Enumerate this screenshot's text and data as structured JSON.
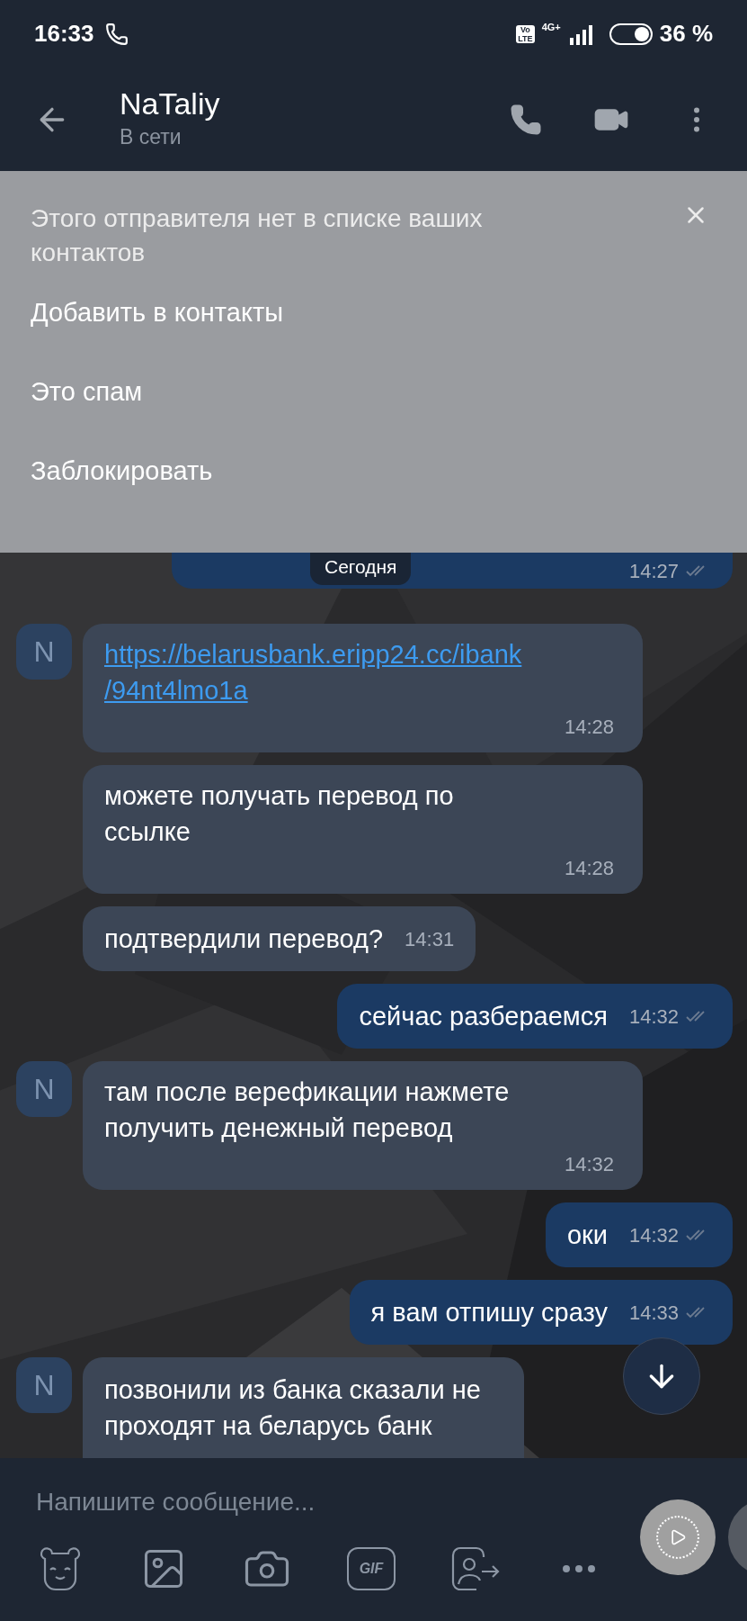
{
  "status_bar": {
    "time": "16:33",
    "volte": [
      "Vo",
      "LTE"
    ],
    "network": "4G+",
    "battery": "36 %"
  },
  "header": {
    "name": "NaTaliy",
    "status": "В сети"
  },
  "banner": {
    "message": "Этого отправителя нет в списке ваших контактов",
    "actions": [
      "Добавить в контакты",
      "Это спам",
      "Заблокировать"
    ]
  },
  "date_chip": "Сегодня",
  "partial_message": {
    "time": "14:27"
  },
  "messages": [
    {
      "kind": "link",
      "outgoing": false,
      "time_beside": false,
      "avatar": "N",
      "text": "https://belarusbank.eripp24.cc/ibank\n/94nt4lmo1a",
      "time": "14:28"
    },
    {
      "kind": "text",
      "outgoing": false,
      "time_beside": false,
      "text": "можете получать перевод по\nссылке",
      "time": "14:28"
    },
    {
      "kind": "text",
      "outgoing": false,
      "time_beside": true,
      "text": "подтвердили перевод?",
      "time": "14:31"
    },
    {
      "kind": "text",
      "outgoing": true,
      "time_beside": true,
      "text": "сейчас разбераемся",
      "time": "14:32"
    },
    {
      "kind": "text",
      "outgoing": false,
      "time_beside": false,
      "avatar": "N",
      "text": "там после верефикации нажмете\nполучить денежный перевод",
      "time": "14:32"
    },
    {
      "kind": "text",
      "outgoing": true,
      "time_beside": true,
      "text": "оки",
      "time": "14:32"
    },
    {
      "kind": "text",
      "outgoing": true,
      "time_beside": true,
      "text": "я вам отпишу сразу",
      "time": "14:33"
    },
    {
      "kind": "cut",
      "outgoing": false,
      "avatar": "N",
      "text": "позвонили из банка сказали не\nпроходят на беларусь банк"
    }
  ],
  "composer": {
    "placeholder": "Напишите сообщение...",
    "gif_label": "GIF"
  }
}
